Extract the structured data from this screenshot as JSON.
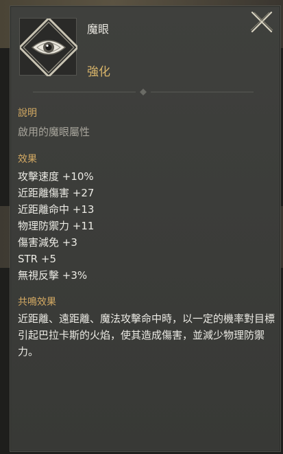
{
  "item": {
    "name": "魔眼",
    "grade": "強化",
    "icon": "eye-emblem-icon"
  },
  "description": {
    "header": "說明",
    "text": "啟用的魔眼屬性"
  },
  "effects": {
    "header": "效果",
    "lines": [
      "攻擊速度 +10%",
      "近距離傷害 +27",
      "近距離命中 +13",
      "物理防禦力 +11",
      "傷害減免 +3",
      "STR +5",
      "無視反擊 +3%"
    ]
  },
  "resonance": {
    "header": "共鳴效果",
    "text": "近距離、遠距離、魔法攻擊命中時，以一定的機率對目標引起巴拉卡斯的火焰，使其造成傷害，並減少物理防禦力。"
  },
  "colors": {
    "header": "#d4aa63",
    "grade": "#d9b56a",
    "value_text": "#ecebe5",
    "muted_text": "#a8a59c"
  }
}
